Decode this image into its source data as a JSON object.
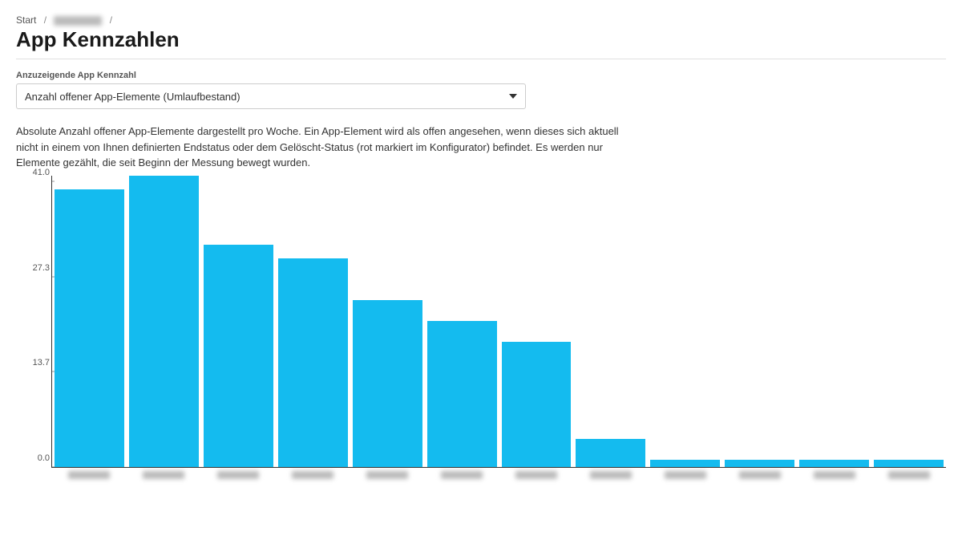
{
  "breadcrumb": {
    "start": "Start"
  },
  "header": {
    "title": "App Kennzahlen"
  },
  "filter": {
    "label": "Anzuzeigende App Kennzahl",
    "selected": "Anzahl offener App-Elemente (Umlaufbestand)"
  },
  "description": "Absolute Anzahl offener App-Elemente dargestellt pro Woche. Ein App-Element wird als offen angesehen, wenn dieses sich aktuell nicht in einem von Ihnen definierten Endstatus oder dem Gelöscht-Status (rot markiert im Konfigurator) befindet. Es werden nur Elemente gezählt, die seit Beginn der Messung bewegt wurden.",
  "chart_data": {
    "type": "bar",
    "categories": [
      "",
      "",
      "",
      "",
      "",
      "",
      "",
      "",
      "",
      "",
      "",
      ""
    ],
    "values": [
      40,
      42,
      32,
      30,
      24,
      21,
      18,
      4,
      1,
      1,
      1,
      1
    ],
    "title": "",
    "xlabel": "",
    "ylabel": "",
    "ylim": [
      0,
      42
    ],
    "y_ticks": [
      0.0,
      13.7,
      27.3,
      41.0
    ]
  }
}
